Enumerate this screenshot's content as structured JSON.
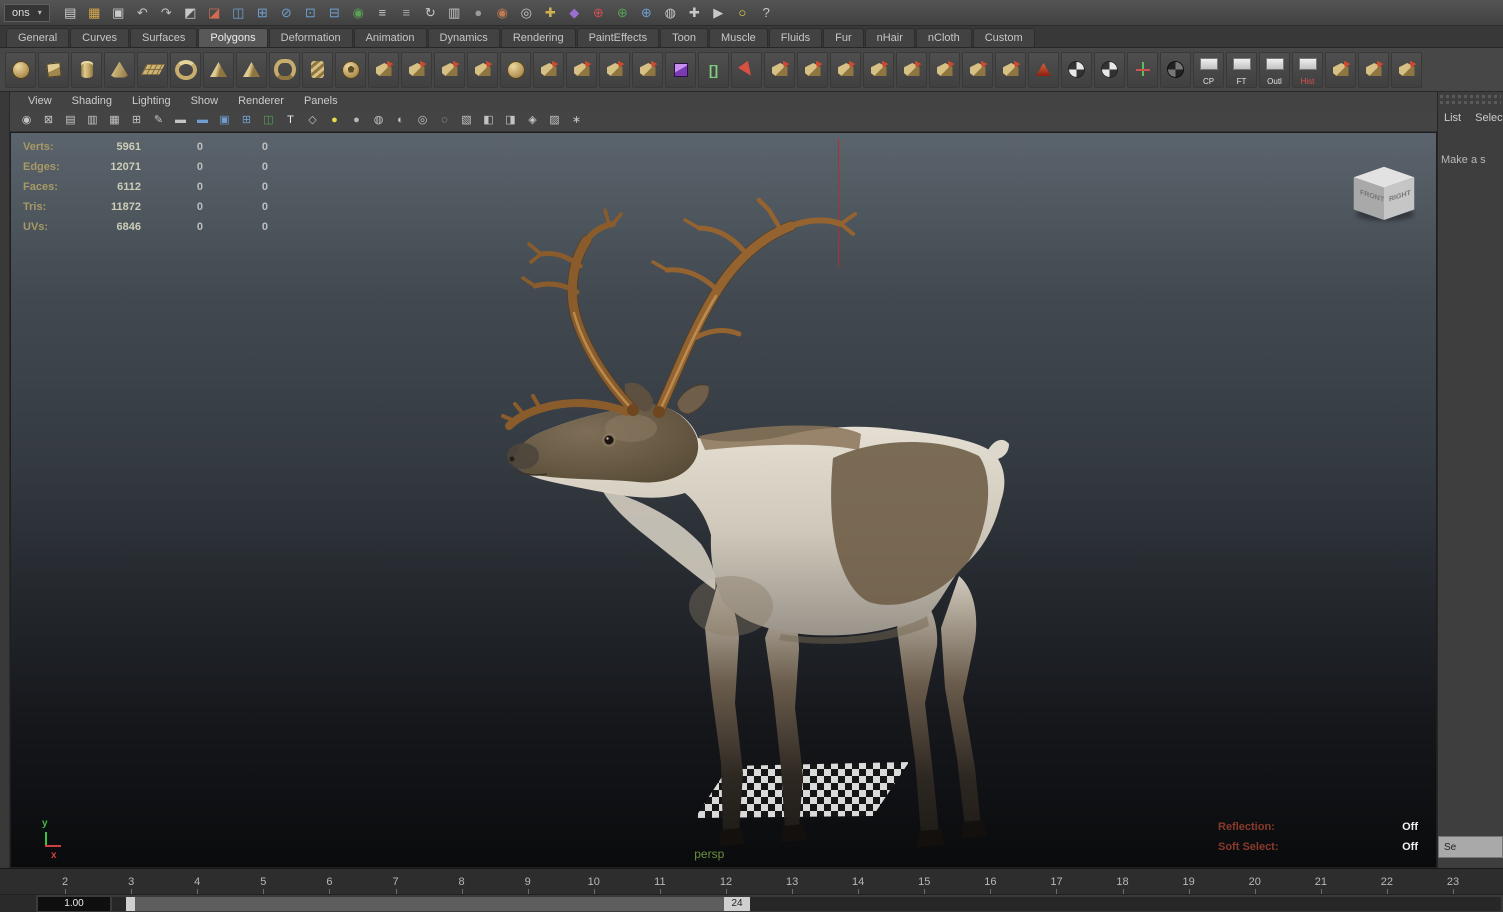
{
  "app": {
    "menuset_partial": "ons"
  },
  "topbar": {
    "icons": [
      {
        "name": "new-scene",
        "ch": "▤",
        "c": "#d0d0d0"
      },
      {
        "name": "open-scene",
        "ch": "▦",
        "c": "#d8a84b"
      },
      {
        "name": "save-scene",
        "ch": "▣",
        "c": "#c9c9c9"
      },
      {
        "name": "undo",
        "ch": "↶",
        "c": "#c4c4c4"
      },
      {
        "name": "redo",
        "ch": "↷",
        "c": "#c4c4c4"
      },
      {
        "name": "select-hierarchy",
        "ch": "◩",
        "c": "#c8c8c8"
      },
      {
        "name": "select-object",
        "ch": "◪",
        "c": "#d06a50"
      },
      {
        "name": "select-component",
        "ch": "◫",
        "c": "#6f9fd0"
      },
      {
        "name": "snap-to-grid",
        "ch": "⊞",
        "c": "#6f9fd0"
      },
      {
        "name": "snap-to-curve",
        "ch": "⊘",
        "c": "#6f9fd0"
      },
      {
        "name": "snap-to-point",
        "ch": "⊡",
        "c": "#6f9fd0"
      },
      {
        "name": "snap-to-plane",
        "ch": "⊟",
        "c": "#6f9fd0"
      },
      {
        "name": "make-live",
        "ch": "◉",
        "c": "#58a058"
      },
      {
        "name": "input-connections",
        "ch": "≡",
        "c": "#c8c8c8"
      },
      {
        "name": "output-connections",
        "ch": "≡",
        "c": "#a8a8a8"
      },
      {
        "name": "construction-history",
        "ch": "↻",
        "c": "#c8c8c8"
      },
      {
        "name": "open-render-view",
        "ch": "▥",
        "c": "#c8c8c8"
      },
      {
        "name": "quick-render",
        "ch": "●",
        "c": "#9a9a9a"
      },
      {
        "name": "ipr-render",
        "ch": "◉",
        "c": "#c07a50"
      },
      {
        "name": "render-settings",
        "ch": "◎",
        "c": "#c8c8c8"
      },
      {
        "name": "paint-effects",
        "ch": "✚",
        "c": "#d0b050"
      },
      {
        "name": "hypershade",
        "ch": "◆",
        "c": "#9a6fd0"
      },
      {
        "name": "symmetry-x",
        "ch": "⊕",
        "c": "#d05050"
      },
      {
        "name": "symmetry-y",
        "ch": "⊕",
        "c": "#58a058"
      },
      {
        "name": "symmetry-z",
        "ch": "⊕",
        "c": "#6f9fd0"
      },
      {
        "name": "soft-modification",
        "ch": "◍",
        "c": "#c8c8c8"
      },
      {
        "name": "show-manipulators",
        "ch": "✚",
        "c": "#c8c8c8"
      },
      {
        "name": "camera-view",
        "ch": "▶",
        "c": "#c8c8c8"
      },
      {
        "name": "light-mode",
        "ch": "○",
        "c": "#e8d84b"
      },
      {
        "name": "help",
        "ch": "?",
        "c": "#c8c8c8"
      }
    ]
  },
  "tabs": {
    "items": [
      {
        "name": "general",
        "label": "General"
      },
      {
        "name": "curves",
        "label": "Curves"
      },
      {
        "name": "surfaces",
        "label": "Surfaces"
      },
      {
        "name": "polygons",
        "label": "Polygons",
        "cls": "active"
      },
      {
        "name": "deformation",
        "label": "Deformation"
      },
      {
        "name": "animation",
        "label": "Animation"
      },
      {
        "name": "dynamics",
        "label": "Dynamics"
      },
      {
        "name": "rendering",
        "label": "Rendering"
      },
      {
        "name": "painteffects",
        "label": "PaintEffects"
      },
      {
        "name": "toon",
        "label": "Toon"
      },
      {
        "name": "muscle",
        "label": "Muscle"
      },
      {
        "name": "fluids",
        "label": "Fluids"
      },
      {
        "name": "fur",
        "label": "Fur"
      },
      {
        "name": "nhair",
        "label": "nHair"
      },
      {
        "name": "ncloth",
        "label": "nCloth"
      },
      {
        "name": "custom",
        "label": "Custom"
      }
    ]
  },
  "shelf": {
    "icons": [
      {
        "name": "poly-sphere",
        "g": "g-sphere",
        "t": ""
      },
      {
        "name": "poly-cube",
        "g": "g-cube",
        "t": ""
      },
      {
        "name": "poly-cylinder",
        "g": "g-cyl",
        "t": ""
      },
      {
        "name": "poly-cone",
        "g": "g-cone",
        "t": ""
      },
      {
        "name": "poly-plane",
        "g": "g-plane",
        "t": ""
      },
      {
        "name": "poly-torus",
        "g": "g-torus",
        "t": ""
      },
      {
        "name": "poly-prism",
        "g": "g-pyramid",
        "t": ""
      },
      {
        "name": "poly-pyramid",
        "g": "g-pyramid",
        "t": ""
      },
      {
        "name": "poly-pipe",
        "g": "g-pipe",
        "t": ""
      },
      {
        "name": "poly-helix",
        "g": "g-helix",
        "t": ""
      },
      {
        "name": "poly-soccer-ball",
        "g": "g-ball",
        "t": ""
      },
      {
        "name": "combine",
        "g": "g-tool",
        "t": ""
      },
      {
        "name": "separate",
        "g": "g-tool",
        "t": ""
      },
      {
        "name": "extract",
        "g": "g-tool",
        "t": ""
      },
      {
        "name": "booleans",
        "g": "g-tool",
        "t": ""
      },
      {
        "name": "smooth",
        "g": "g-sphere",
        "t": ""
      },
      {
        "name": "reduce",
        "g": "g-tool",
        "t": ""
      },
      {
        "name": "triangulate",
        "g": "g-tool",
        "t": ""
      },
      {
        "name": "quadrangulate",
        "g": "g-tool",
        "t": ""
      },
      {
        "name": "fill-hole",
        "g": "g-tool",
        "t": ""
      },
      {
        "name": "subdiv-proxy",
        "g": "g-purple",
        "t": ""
      },
      {
        "name": "crease-tool",
        "g": "g-bracket",
        "t": ""
      },
      {
        "name": "select-arrow",
        "g": "g-cursor",
        "t": ""
      },
      {
        "name": "extrude",
        "g": "g-tool",
        "t": ""
      },
      {
        "name": "bridge",
        "g": "g-tool",
        "t": ""
      },
      {
        "name": "append-to-polygon",
        "g": "g-tool",
        "t": ""
      },
      {
        "name": "cut-faces",
        "g": "g-tool",
        "t": ""
      },
      {
        "name": "interactive-split",
        "g": "g-tool",
        "t": ""
      },
      {
        "name": "insert-edge-loop",
        "g": "g-tool",
        "t": ""
      },
      {
        "name": "offset-edge-loop",
        "g": "g-tool",
        "t": ""
      },
      {
        "name": "add-divisions",
        "g": "g-tool",
        "t": ""
      },
      {
        "name": "sculpt-geometry",
        "g": "g-red",
        "t": ""
      },
      {
        "name": "transfer-attributes",
        "g": "g-checkball",
        "t": ""
      },
      {
        "name": "paint-vertex-color",
        "g": "g-checkball",
        "t": ""
      },
      {
        "name": "clipboard-axis",
        "g": "g-axis",
        "t": ""
      },
      {
        "name": "toggle-display",
        "g": "g-dark",
        "t": ""
      },
      {
        "name": "cp",
        "g": "g-label",
        "t": "CP"
      },
      {
        "name": "ft",
        "g": "g-label",
        "t": "FT"
      },
      {
        "name": "outliner",
        "g": "g-label",
        "t": "Outl"
      },
      {
        "name": "history",
        "g": "g-label",
        "t": "Hist",
        "tc": "#e05050"
      },
      {
        "name": "quad-draw",
        "g": "g-tool",
        "t": ""
      },
      {
        "name": "multi-cut",
        "g": "g-tool",
        "t": ""
      },
      {
        "name": "target-weld",
        "g": "g-tool",
        "t": ""
      }
    ]
  },
  "panel": {
    "menu": [
      {
        "name": "view",
        "label": "View"
      },
      {
        "name": "shading",
        "label": "Shading"
      },
      {
        "name": "lighting",
        "label": "Lighting"
      },
      {
        "name": "show",
        "label": "Show"
      },
      {
        "name": "renderer",
        "label": "Renderer"
      },
      {
        "name": "panels",
        "label": "Panels"
      }
    ]
  },
  "vptoolbar": {
    "icons": [
      {
        "name": "select-camera",
        "ch": "◉",
        "c": "#c4c4c4"
      },
      {
        "name": "lock-camera",
        "ch": "⊠",
        "c": "#c4c4c4"
      },
      {
        "name": "camera-attributes",
        "ch": "▤",
        "c": "#c4c4c4"
      },
      {
        "name": "bookmarks",
        "ch": "▥",
        "c": "#c4c4c4"
      },
      {
        "name": "image-plane",
        "ch": "▦",
        "c": "#c4c4c4"
      },
      {
        "name": "two-d-pan-zoom",
        "ch": "⊞",
        "c": "#c4c4c4"
      },
      {
        "name": "grease-pencil",
        "ch": "✎",
        "c": "#c4c4c4"
      },
      {
        "name": "film-gate",
        "ch": "▬",
        "c": "#c4c4c4"
      },
      {
        "name": "resolution-gate",
        "ch": "▬",
        "c": "#6f9fd0"
      },
      {
        "name": "gate-mask",
        "ch": "▣",
        "c": "#6f9fd0"
      },
      {
        "name": "field-chart",
        "ch": "⊞",
        "c": "#6f9fd0"
      },
      {
        "name": "safe-action",
        "ch": "◫",
        "c": "#58a058"
      },
      {
        "name": "safe-title",
        "ch": "T",
        "c": "#e8e8e8"
      },
      {
        "name": "wireframe",
        "ch": "◇",
        "c": "#c4c4c4"
      },
      {
        "name": "use-all-lights",
        "ch": "●",
        "c": "#e8d84b"
      },
      {
        "name": "smooth-shade",
        "ch": "●",
        "c": "#b8b8b8"
      },
      {
        "name": "textured",
        "ch": "◍",
        "c": "#c4c4c4"
      },
      {
        "name": "shadows",
        "ch": "◐",
        "c": "#c4c4c4"
      },
      {
        "name": "screen-space-ao",
        "ch": "◎",
        "c": "#c4c4c4"
      },
      {
        "name": "motion-blur",
        "ch": "◌",
        "c": "#c4c4c4"
      },
      {
        "name": "multisampling",
        "ch": "▧",
        "c": "#c4c4c4"
      },
      {
        "name": "isolate-select",
        "ch": "◧",
        "c": "#c4c4c4"
      },
      {
        "name": "xray",
        "ch": "◨",
        "c": "#c4c4c4"
      },
      {
        "name": "exposure",
        "ch": "◈",
        "c": "#c4c4c4"
      },
      {
        "name": "default-material",
        "ch": "▨",
        "c": "#c4c4c4"
      },
      {
        "name": "share-view",
        "ch": "∗",
        "c": "#c4c4c4"
      }
    ]
  },
  "hud": {
    "stats": [
      {
        "label": "Verts:",
        "value": "5961",
        "c1": "0",
        "c2": "0"
      },
      {
        "label": "Edges:",
        "value": "12071",
        "c1": "0",
        "c2": "0"
      },
      {
        "label": "Faces:",
        "value": "6112",
        "c1": "0",
        "c2": "0"
      },
      {
        "label": "Tris:",
        "value": "11872",
        "c1": "0",
        "c2": "0"
      },
      {
        "label": "UVs:",
        "value": "6846",
        "c1": "0",
        "c2": "0"
      }
    ],
    "reflection_label": "Reflection:",
    "reflection_value": "Off",
    "soft_select_label": "Soft Select:",
    "soft_select_value": "Off",
    "camera": "persp"
  },
  "viewcube": {
    "left": "FRONT",
    "right": "RIGHT"
  },
  "right_panel": {
    "menu_left": "List",
    "menu_right": "Select",
    "hint": "Make a s",
    "button": "Se"
  },
  "timeline": {
    "frames": [
      "2",
      "3",
      "4",
      "5",
      "6",
      "7",
      "8",
      "9",
      "10",
      "11",
      "12",
      "13",
      "14",
      "15",
      "16",
      "17",
      "18",
      "19",
      "20",
      "21",
      "22",
      "23"
    ]
  },
  "range": {
    "current": "1.00",
    "end": "24"
  },
  "axis": {
    "x": "x",
    "y": "y"
  }
}
